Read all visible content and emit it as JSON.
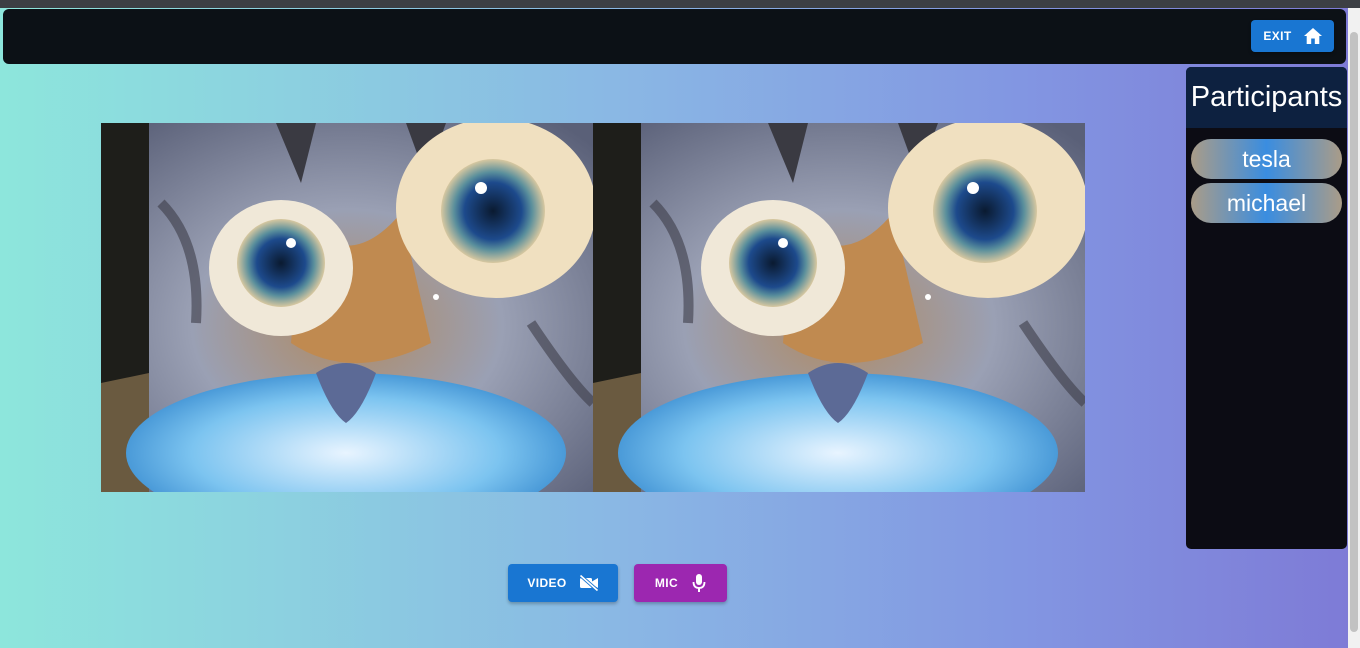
{
  "topbar": {
    "exit_label": "EXIT",
    "exit_icon": "home-icon"
  },
  "videos": [
    {
      "feed": "cat-face-video",
      "participant": "tesla"
    },
    {
      "feed": "cat-face-video",
      "participant": "michael"
    }
  ],
  "controls": {
    "video_label": "VIDEO",
    "video_icon": "video-off-icon",
    "mic_label": "MIC",
    "mic_icon": "mic-icon"
  },
  "participants_panel": {
    "title": "Participants",
    "items": [
      {
        "label": "tesla"
      },
      {
        "label": "michael"
      }
    ]
  },
  "colors": {
    "primary": "#1976d2",
    "secondary": "#9c27b0",
    "panel_bg": "#0c0c14",
    "panel_header": "#0d2140",
    "topbar_bg": "#0c1116"
  }
}
